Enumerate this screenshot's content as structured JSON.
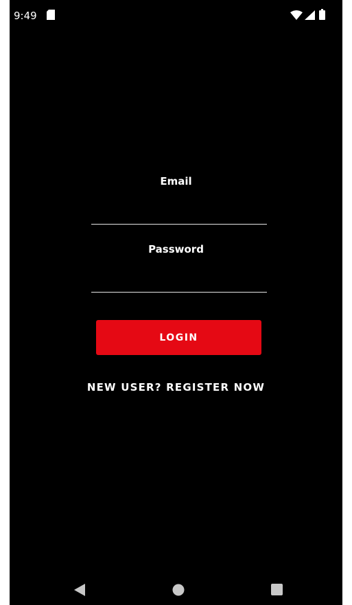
{
  "status_bar": {
    "time": "9:49",
    "icons": [
      "sd-card-icon",
      "wifi-icon",
      "signal-icon",
      "battery-icon"
    ]
  },
  "form": {
    "email_label": "Email",
    "email_value": "",
    "password_label": "Password",
    "password_value": "",
    "login_label": "LOGIN",
    "register_label": "NEW USER? REGISTER NOW"
  },
  "nav_bar": {
    "icons": [
      "back-icon",
      "home-icon",
      "recent-apps-icon"
    ]
  },
  "colors": {
    "background": "#000000",
    "accent": "#e50914",
    "text": "#ffffff",
    "underline": "#e6e6e6",
    "nav_icon": "#c8c8c8"
  }
}
